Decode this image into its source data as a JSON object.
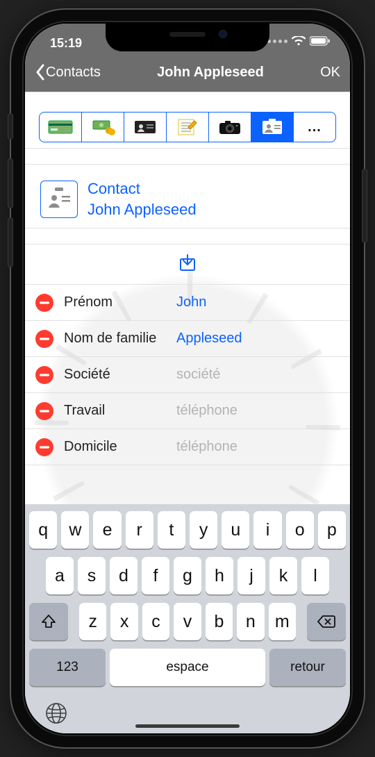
{
  "status": {
    "time": "15:19"
  },
  "nav": {
    "back": "Contacts",
    "title": "John Appleseed",
    "ok": "OK"
  },
  "colors": {
    "accent": "#0b62ff",
    "danger": "#ff3b30"
  },
  "segmented": {
    "tabs": [
      {
        "name": "credit-card-icon"
      },
      {
        "name": "money-icon"
      },
      {
        "name": "id-card-icon"
      },
      {
        "name": "notes-icon"
      },
      {
        "name": "camera-icon"
      },
      {
        "name": "contact-icon",
        "active": true
      },
      {
        "name": "more",
        "label": "..."
      }
    ]
  },
  "summary": {
    "type_label": "Contact",
    "name": "John Appleseed"
  },
  "fields": [
    {
      "label": "Prénom",
      "value": "John",
      "placeholder": ""
    },
    {
      "label": "Nom de familie",
      "value": "Appleseed",
      "placeholder": ""
    },
    {
      "label": "Société",
      "value": "",
      "placeholder": "société"
    },
    {
      "label": "Travail",
      "value": "",
      "placeholder": "téléphone"
    },
    {
      "label": "Domicile",
      "value": "",
      "placeholder": "téléphone"
    }
  ],
  "keyboard": {
    "row1": [
      "q",
      "w",
      "e",
      "r",
      "t",
      "y",
      "u",
      "i",
      "o",
      "p"
    ],
    "row2": [
      "a",
      "s",
      "d",
      "f",
      "g",
      "h",
      "j",
      "k",
      "l"
    ],
    "row3": [
      "z",
      "x",
      "c",
      "v",
      "b",
      "n",
      "m"
    ],
    "numKey": "123",
    "space": "espace",
    "ret": "retour"
  }
}
